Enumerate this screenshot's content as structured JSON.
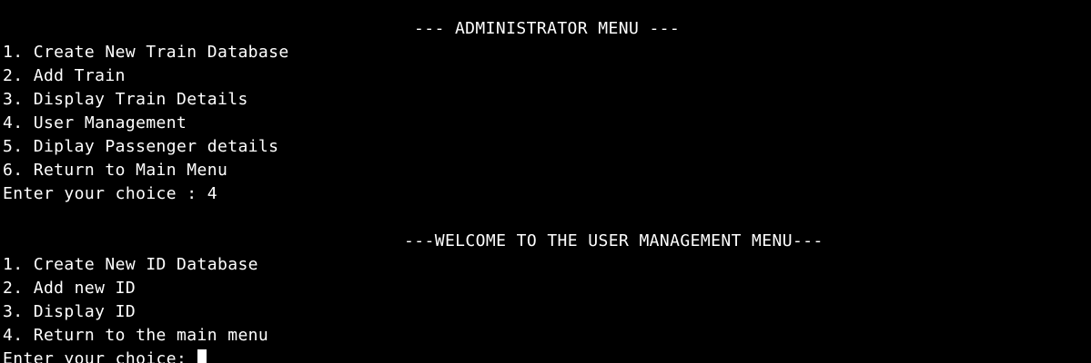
{
  "terminal": {
    "admin_menu": {
      "title": "--- ADMINISTRATOR MENU ---",
      "options": [
        "1. Create New Train Database",
        "2. Add Train",
        "3. Display Train Details",
        "4. User Management",
        "5. Diplay Passenger details",
        "6. Return to Main Menu"
      ],
      "prompt": "Enter your choice : 4"
    },
    "user_menu": {
      "title": "---WELCOME TO THE USER MANAGEMENT MENU---",
      "options": [
        "1. Create New ID Database",
        "2. Add new ID",
        "3. Display ID",
        "4. Return to the main menu"
      ],
      "prompt": "Enter your choice: "
    },
    "colors": {
      "background": "#000000",
      "text": "#ffffff"
    }
  }
}
